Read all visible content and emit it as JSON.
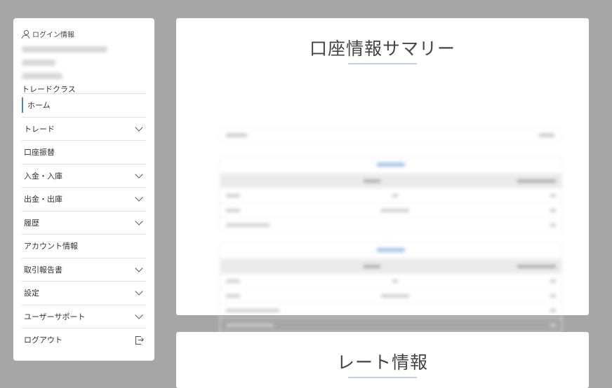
{
  "sidebar": {
    "login_title": "ログイン情報",
    "trade_class": "トレードクラス",
    "items": [
      {
        "label": "ホーム",
        "expandable": false
      },
      {
        "label": "トレード",
        "expandable": true
      },
      {
        "label": "口座振替",
        "expandable": false
      },
      {
        "label": "入金・入庫",
        "expandable": true
      },
      {
        "label": "出金・出庫",
        "expandable": true
      },
      {
        "label": "履歴",
        "expandable": true
      },
      {
        "label": "アカウント情報",
        "expandable": false
      },
      {
        "label": "取引報告書",
        "expandable": true
      },
      {
        "label": "設定",
        "expandable": true
      },
      {
        "label": "ユーザーサポート",
        "expandable": true
      },
      {
        "label": "ログアウト",
        "expandable": false
      }
    ]
  },
  "summary": {
    "title": "口座情報サマリー"
  },
  "rates": {
    "title": "レート情報"
  },
  "colors": {
    "background": "#a6a6a6",
    "accent": "#3a8fb5",
    "underline": "#b9d4ea"
  }
}
